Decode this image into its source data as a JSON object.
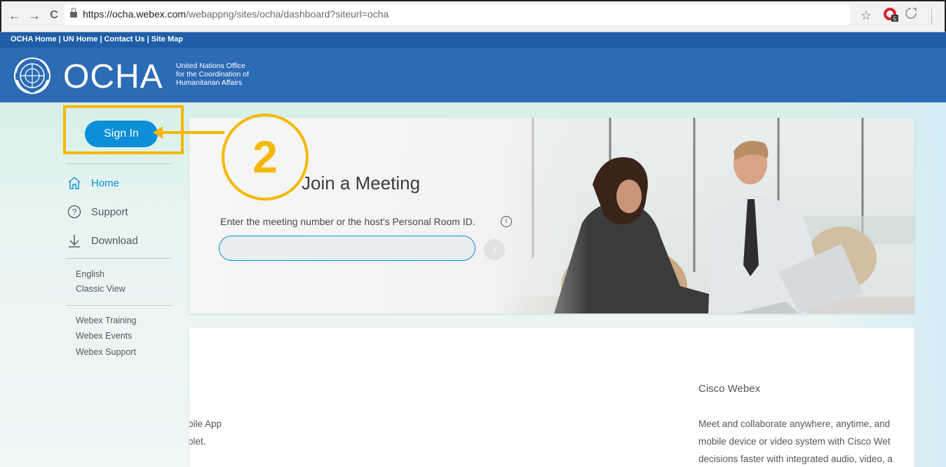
{
  "browser": {
    "back": "←",
    "forward": "→",
    "reload": "C",
    "url_host": "https://ocha.webex.com",
    "url_path": "/webappng/sites/ocha/dashboard?siteurl=ocha",
    "star": "☆",
    "ext_badge": "5"
  },
  "header": {
    "top_links": "OCHA Home | UN Home | Contact Us | Site Map",
    "logo_text": "OCHA",
    "subtitle_line1": "United Nations Office",
    "subtitle_line2": "for the Coordination of",
    "subtitle_line3": "Humanitarian Affairs"
  },
  "sidebar": {
    "signin_label": "Sign In",
    "nav": [
      {
        "label": "Home",
        "icon": "home-icon"
      },
      {
        "label": "Support",
        "icon": "help-icon"
      },
      {
        "label": "Download",
        "icon": "download-icon"
      }
    ],
    "language": "English",
    "classic_view": "Classic View",
    "links": [
      "Webex Training",
      "Webex Events",
      "Webex Support"
    ]
  },
  "hero": {
    "title": "Join a Meeting",
    "input_label": "Enter the meeting number or the host's Personal Room ID.",
    "info_glyph": "i",
    "input_value": "",
    "go_glyph": "›"
  },
  "lower": {
    "mobile_line1": "bile App",
    "mobile_line2": "blet.",
    "webex_title": "Cisco Webex",
    "webex_lines": [
      "Meet and collaborate anywhere, anytime, and",
      "mobile device or video system with Cisco Wet",
      "decisions faster with integrated audio, video, a"
    ]
  },
  "annotation": {
    "step_number": "2"
  },
  "colors": {
    "accent": "#0a8fd8",
    "brand_blue": "#2c6bb5",
    "annotation": "#f5b800"
  }
}
